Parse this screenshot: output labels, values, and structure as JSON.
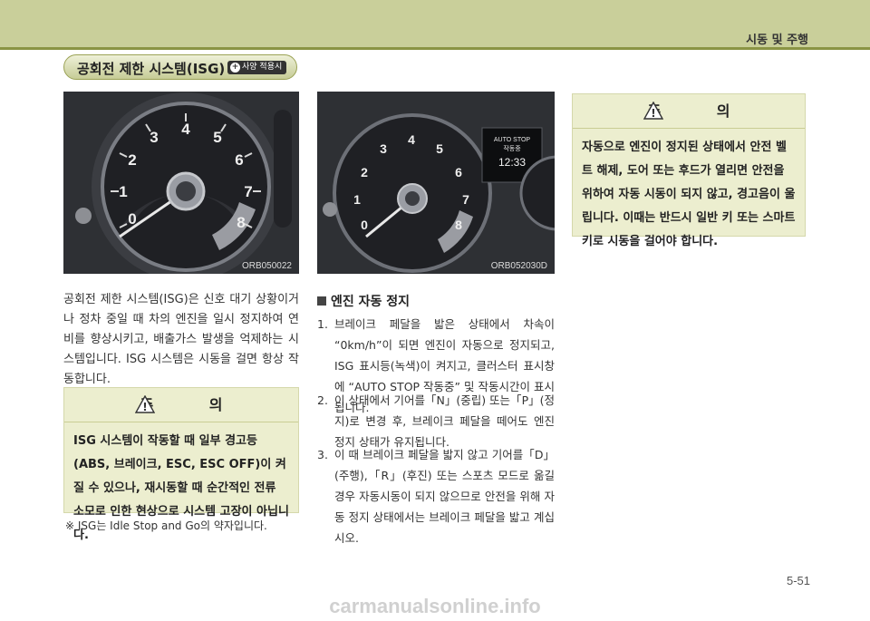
{
  "header": {
    "running_head": "시동 및 주행"
  },
  "section": {
    "title": "공회전 제한 시스템(ISG)",
    "badge": "사양 적용시",
    "badge_symbol": "+"
  },
  "figures": [
    {
      "code": "ORB050022",
      "gauge_numbers": [
        "0",
        "1",
        "2",
        "3",
        "4",
        "5",
        "6",
        "7",
        "8"
      ]
    },
    {
      "code": "ORB052030D",
      "gauge_numbers": [
        "0",
        "1",
        "2",
        "3",
        "4",
        "5",
        "6",
        "7",
        "8"
      ],
      "display": {
        "line1": "AUTO STOP",
        "line2": "작동중",
        "time": "12:33"
      }
    }
  ],
  "intro_paragraph": "공회전 제한 시스템(ISG)은 신호 대기 상황이거나 정차 중일 때 차의 엔진을 일시 정지하여 연비를 향상시키고, 배출가스 발생을 억제하는 시스템입니다. ISG 시스템은 시동을 걸면 항상 작동합니다.",
  "caution_left": {
    "symbol": "!",
    "heading": "주 의",
    "body": "ISG 시스템이 작동할 때 일부 경고등(ABS, 브레이크, ESC, ESC OFF)이 켜질 수 있으나, 재시동할 때 순간적인 전류 소모로 인한 현상으로 시스템 고장이 아닙니다."
  },
  "note": "※ ISG는 Idle Stop and Go의 약자입니다.",
  "caution_right": {
    "symbol": "!",
    "heading": "주 의",
    "body": "자동으로 엔진이 정지된 상태에서 안전 벨트 해제, 도어 또는 후드가 열리면 안전을 위하여 자동 시동이 되지 않고, 경고음이 울립니다. 이때는 반드시 일반 키 또는 스마트 키로 시동을 걸어야 합니다."
  },
  "subsection": {
    "title": "엔진 자동 정지"
  },
  "steps": [
    {
      "num": "1.",
      "text": "브레이크 페달을 밟은 상태에서 차속이 “0km/h”이 되면 엔진이 자동으로 정지되고, ISG 표시등(녹색)이 켜지고, 클러스터 표시창에 “AUTO STOP 작동중” 및 작동시간이 표시됩니다."
    },
    {
      "num": "2.",
      "text": "이 상태에서 기어를「N」(중립) 또는「P」(정지)로 변경 후, 브레이크 페달을 떼어도 엔진 정지 상태가 유지됩니다."
    },
    {
      "num": "3.",
      "text": "이 때 브레이크 페달을 밟지 않고 기어를「D」(주행),「R」(후진) 또는 스포츠 모드로 옮길 경우 자동시동이 되지 않으므로 안전을 위해 자동 정지 상태에서는 브레이크 페달을 밟고 계십시오."
    }
  ],
  "footer": {
    "page_number": "5-51",
    "watermark": "carmanualsonline.info"
  },
  "colors": {
    "header_band": "#c9cf9a",
    "header_line": "#8a9444",
    "caution_bg": "#eceecf"
  }
}
